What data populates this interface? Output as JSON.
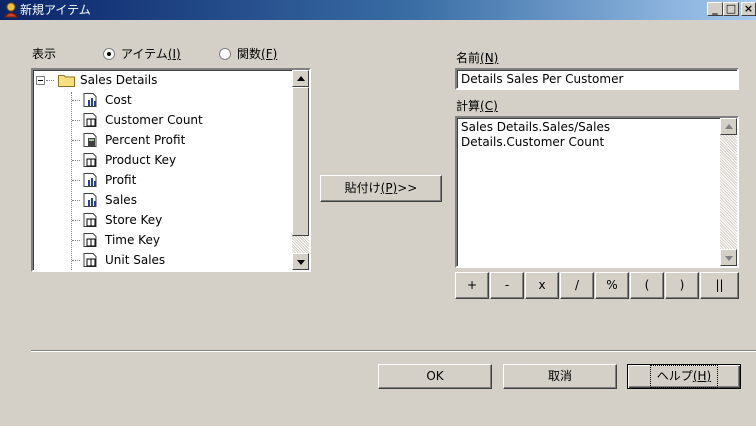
{
  "window": {
    "title": "新規アイテム",
    "min": "_",
    "max": "□",
    "close": "×"
  },
  "display": {
    "label": "表示",
    "radio_items": {
      "label_main": "アイテム",
      "label_key": "(I)",
      "checked": true
    },
    "radio_functions": {
      "label_main": "関数",
      "label_key": "(F)",
      "checked": false
    }
  },
  "tree": {
    "root": "Sales Details",
    "items": [
      {
        "label": "Cost",
        "icon": "measure-icon"
      },
      {
        "label": "Customer Count",
        "icon": "dimension-icon"
      },
      {
        "label": "Percent Profit",
        "icon": "calc-measure-icon"
      },
      {
        "label": "Product Key",
        "icon": "dimension-icon"
      },
      {
        "label": "Profit",
        "icon": "measure-icon"
      },
      {
        "label": "Sales",
        "icon": "measure-icon"
      },
      {
        "label": "Store Key",
        "icon": "dimension-icon"
      },
      {
        "label": "Time Key",
        "icon": "dimension-icon"
      },
      {
        "label": "Unit Sales",
        "icon": "dimension-icon"
      }
    ]
  },
  "paste_button": {
    "label_main": "貼付け",
    "label_key": "(P)",
    "label_suffix": " >>"
  },
  "name": {
    "label_main": "名前",
    "label_key": "(N)",
    "value": "Details Sales Per Customer"
  },
  "calc": {
    "label_main": "計算",
    "label_key": "(C)",
    "value": "Sales Details.Sales/Sales\nDetails.Customer Count"
  },
  "operators": [
    "+",
    "-",
    "x",
    "/",
    "%",
    "(",
    ")",
    "||"
  ],
  "footer": {
    "ok": "OK",
    "cancel": "取消",
    "help_main": "ヘルプ",
    "help_key": "(H)"
  }
}
